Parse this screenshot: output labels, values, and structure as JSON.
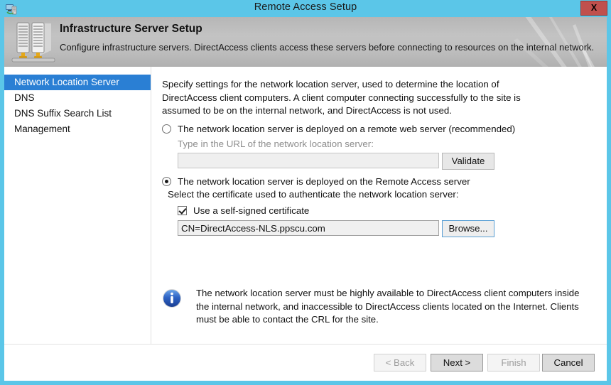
{
  "window": {
    "title": "Remote Access Setup",
    "close_label": "X",
    "titlebar_icon": "remote-access-icon",
    "accent_color": "#5bc6e8",
    "close_color": "#c0504d"
  },
  "banner": {
    "icon": "server-network-icon",
    "title": "Infrastructure Server Setup",
    "subtitle": "Configure infrastructure servers. DirectAccess clients access these servers before connecting to resources on the internal network."
  },
  "sidebar": {
    "items": [
      {
        "label": "Network Location Server",
        "selected": true
      },
      {
        "label": "DNS",
        "selected": false
      },
      {
        "label": "DNS Suffix Search List",
        "selected": false
      },
      {
        "label": "Management",
        "selected": false
      }
    ],
    "selected_color": "#2a7fd4"
  },
  "main": {
    "intro": "Specify settings for the network location server, used to determine the location of DirectAccess client computers. A client computer connecting successfully to the site is assumed to be on the internal network, and DirectAccess is not used.",
    "option_remote": {
      "label": "The network location server is deployed on a remote web server (recommended)",
      "selected": false,
      "url_hint": "Type in the URL of the network location server:",
      "url_value": "",
      "validate_label": "Validate"
    },
    "option_local": {
      "label": "The network location server is deployed on the Remote Access server",
      "selected": true,
      "cert_hint": "Select the certificate used to authenticate the network location server:",
      "self_signed_label": "Use a self-signed certificate",
      "self_signed_checked": true,
      "cert_value": "CN=DirectAccess-NLS.ppscu.com",
      "browse_label": "Browse..."
    },
    "info": {
      "icon": "info-icon",
      "text": "The network location server must be highly available to DirectAccess client computers inside the internal network, and inaccessible to DirectAccess clients located on the Internet. Clients must be able to contact the CRL for the site."
    }
  },
  "footer": {
    "back_label": "< Back",
    "next_label": "Next >",
    "finish_label": "Finish",
    "cancel_label": "Cancel"
  }
}
